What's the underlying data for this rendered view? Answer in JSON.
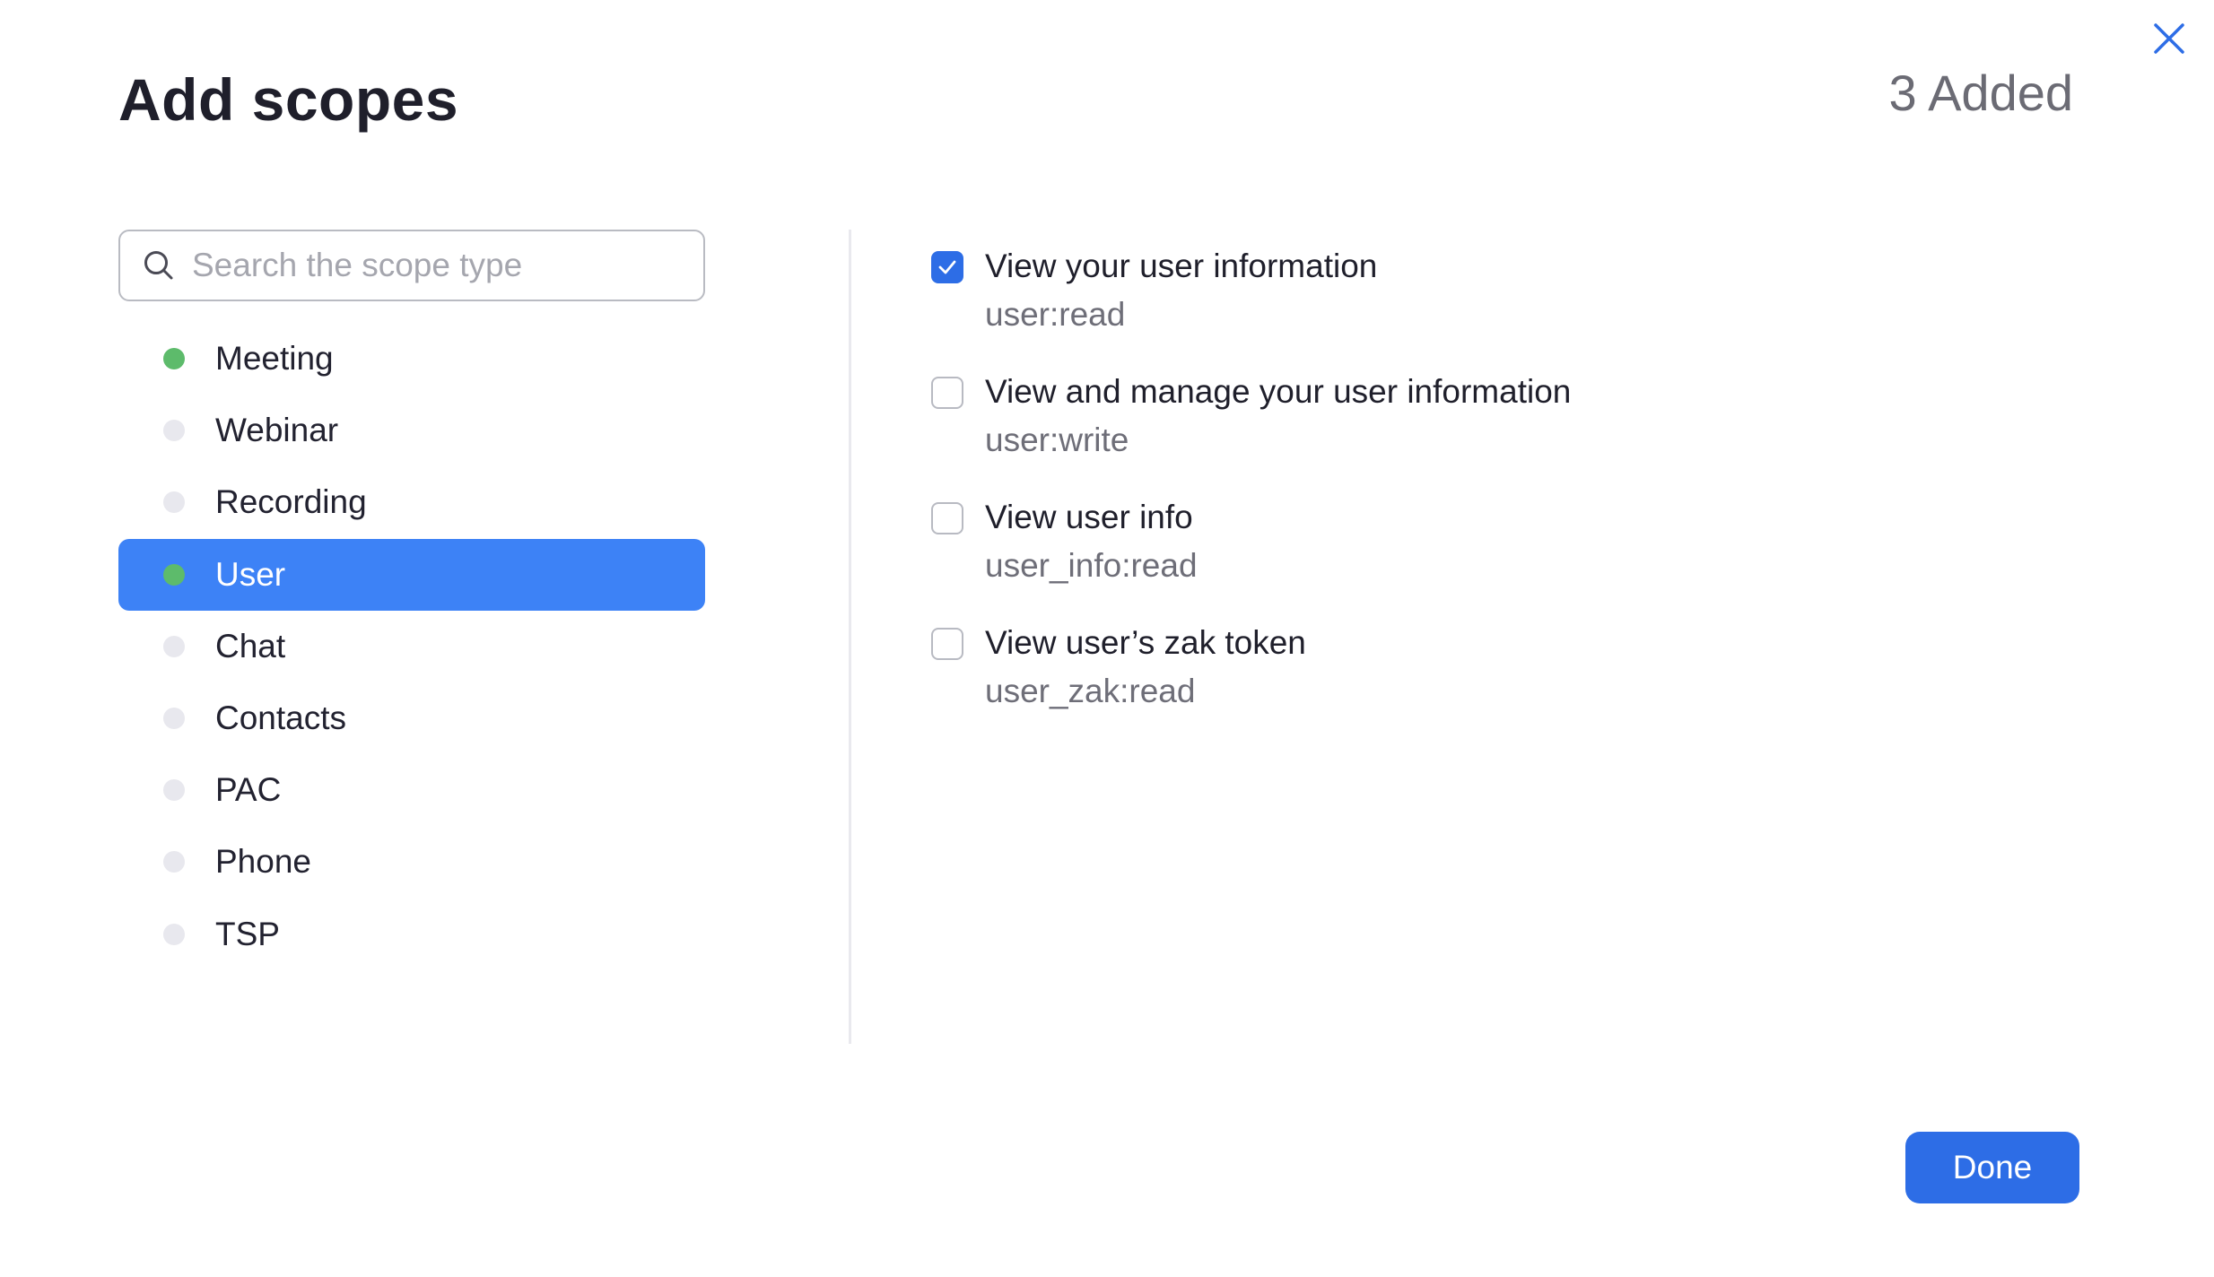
{
  "dialog": {
    "title": "Add scopes",
    "added_count": "3 Added",
    "close_icon": "close-icon"
  },
  "search": {
    "placeholder": "Search the scope type",
    "value": "",
    "icon": "search-icon"
  },
  "categories": [
    {
      "label": "Meeting",
      "has_added": true,
      "selected": false
    },
    {
      "label": "Webinar",
      "has_added": false,
      "selected": false
    },
    {
      "label": "Recording",
      "has_added": false,
      "selected": false
    },
    {
      "label": "User",
      "has_added": true,
      "selected": true
    },
    {
      "label": "Chat",
      "has_added": false,
      "selected": false
    },
    {
      "label": "Contacts",
      "has_added": false,
      "selected": false
    },
    {
      "label": "PAC",
      "has_added": false,
      "selected": false
    },
    {
      "label": "Phone",
      "has_added": false,
      "selected": false
    },
    {
      "label": "TSP",
      "has_added": false,
      "selected": false
    }
  ],
  "scopes": [
    {
      "title": "View your user information",
      "code": "user:read",
      "checked": true
    },
    {
      "title": "View and manage your user information",
      "code": "user:write",
      "checked": false
    },
    {
      "title": "View user info",
      "code": "user_info:read",
      "checked": false
    },
    {
      "title": "View user’s zak token",
      "code": "user_zak:read",
      "checked": false
    }
  ],
  "footer": {
    "done_label": "Done"
  },
  "colors": {
    "primary": "#2d6de6",
    "selected_row": "#3d82f6",
    "added_dot": "#5dbb6b",
    "inactive_dot": "#e8e8ee"
  }
}
